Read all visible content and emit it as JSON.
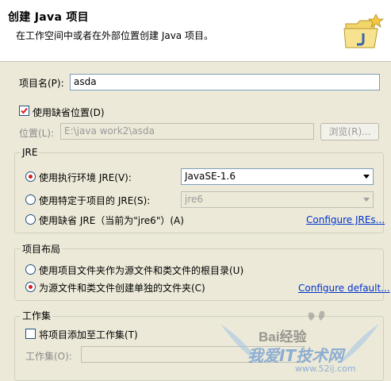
{
  "header": {
    "title": "创建 Java 项目",
    "description": "在工作空间中或者在外部位置创建 Java 项目。"
  },
  "project": {
    "name_label": "项目名(P):",
    "name_value": "asda",
    "use_default_label": "使用缺省位置(D)",
    "use_default_checked": true,
    "location_label": "位置(L):",
    "location_value": "E:\\java work2\\asda",
    "browse_label": "浏览(R)..."
  },
  "jre": {
    "title": "JRE",
    "options": [
      {
        "label": "使用执行环境 JRE(V):",
        "selected": true
      },
      {
        "label": "使用特定于项目的 JRE(S):",
        "selected": false
      },
      {
        "label": "使用缺省 JRE（当前为\"jre6\"）(A)",
        "selected": false
      }
    ],
    "env_value": "JavaSE-1.6",
    "specific_value": "jre6",
    "configure_link": "Configure JREs..."
  },
  "layout": {
    "title": "项目布局",
    "options": [
      {
        "label": "使用项目文件夹作为源文件和类文件的根目录(U)",
        "selected": false
      },
      {
        "label": "为源文件和类文件创建单独的文件夹(C)",
        "selected": true
      }
    ],
    "configure_link": "Configure default..."
  },
  "working_sets": {
    "title": "工作集",
    "add_label": "将项目添加至工作集(T)",
    "add_checked": false,
    "field_label": "工作集(O):"
  },
  "watermark": {
    "brand": "Bai经验",
    "tagline": "我爱IT技术网",
    "site": "www.52ij.com"
  },
  "colors": {
    "accent_red": "#d1211f",
    "link_blue": "#0033cc",
    "panel_bg": "#ece9d8"
  }
}
